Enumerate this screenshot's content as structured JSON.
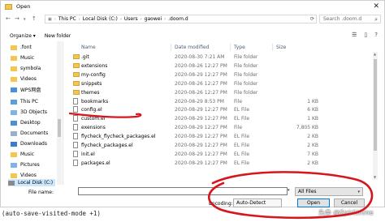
{
  "window": {
    "title": "Open",
    "close_glyph": "✕"
  },
  "address_bar": {
    "breadcrumbs": [
      "This PC",
      "Local Disk (C:)",
      "Users",
      "gaowei",
      ".doom.d"
    ],
    "refresh_glyph": "⟳"
  },
  "search": {
    "placeholder": "Search .doom.d",
    "icon": "search-icon"
  },
  "toolbar": {
    "organize_label": "Organize ▾",
    "new_folder_label": "New folder"
  },
  "nav": {
    "items": [
      {
        "label": ".font",
        "icon": "folder-icon"
      },
      {
        "label": "Music",
        "icon": "music-folder-icon"
      },
      {
        "label": "symbola",
        "icon": "folder-icon"
      },
      {
        "label": "Videos",
        "icon": "videos-folder-icon"
      },
      {
        "label": "WPS网盘",
        "icon": "cloud-drive-icon"
      },
      {
        "label": "This PC",
        "icon": "computer-icon"
      },
      {
        "label": "3D Objects",
        "icon": "3d-objects-icon"
      },
      {
        "label": "Desktop",
        "icon": "desktop-icon"
      },
      {
        "label": "Documents",
        "icon": "documents-icon"
      },
      {
        "label": "Downloads",
        "icon": "downloads-icon"
      },
      {
        "label": "Music",
        "icon": "music-folder-icon"
      },
      {
        "label": "Pictures",
        "icon": "pictures-icon"
      },
      {
        "label": "Videos",
        "icon": "videos-folder-icon"
      },
      {
        "label": "Local Disk (C:)",
        "icon": "drive-icon",
        "selected": true
      }
    ]
  },
  "columns": {
    "name": "Name",
    "date": "Date modified",
    "type": "Type",
    "size": "Size"
  },
  "files": [
    {
      "name": ".git",
      "date": "2020-08-30 7:21 AM",
      "type": "File folder",
      "size": "",
      "kind": "folder"
    },
    {
      "name": "extensions",
      "date": "2020-08-26 12:27 PM",
      "type": "File folder",
      "size": "",
      "kind": "folder"
    },
    {
      "name": "my-config",
      "date": "2020-08-29 12:27 PM",
      "type": "File folder",
      "size": "",
      "kind": "folder"
    },
    {
      "name": "snippets",
      "date": "2020-08-26 12:27 PM",
      "type": "File folder",
      "size": "",
      "kind": "folder"
    },
    {
      "name": "themes",
      "date": "2020-08-26 12:27 PM",
      "type": "File folder",
      "size": "",
      "kind": "folder"
    },
    {
      "name": "bookmarks",
      "date": "2020-08-29 8:53 PM",
      "type": "File",
      "size": "1 KB",
      "kind": "file"
    },
    {
      "name": "config.el",
      "date": "2020-08-29 12:27 PM",
      "type": "EL File",
      "size": "6 KB",
      "kind": "file"
    },
    {
      "name": "custom.el",
      "date": "2020-08-29 12:27 PM",
      "type": "EL File",
      "size": "1 KB",
      "kind": "file"
    },
    {
      "name": "exensions",
      "date": "2020-08-29 12:27 PM",
      "type": "File",
      "size": "7,805 KB",
      "kind": "file"
    },
    {
      "name": "flycheck_flycheck_packages.el",
      "date": "2020-08-29 12:27 PM",
      "type": "EL File",
      "size": "2 KB",
      "kind": "file"
    },
    {
      "name": "flycheck_packages.el",
      "date": "2020-08-29 12:27 PM",
      "type": "EL File",
      "size": "2 KB",
      "kind": "file"
    },
    {
      "name": "init.el",
      "date": "2020-08-29 12:27 PM",
      "type": "EL File",
      "size": "7 KB",
      "kind": "file"
    },
    {
      "name": "packages.el",
      "date": "2020-08-29 12:27 PM",
      "type": "EL File",
      "size": "2 KB",
      "kind": "file"
    }
  ],
  "footer": {
    "file_name_label": "File name:",
    "file_name_value": "",
    "filter_value": "All Files",
    "encoding_label": "Encoding:",
    "encoding_value": "Auto-Detect",
    "open_label": "Open",
    "cancel_label": "Cancel"
  },
  "background": {
    "editor_text": "(auto-save-visited-mode +1)",
    "watermark": "头条 @Spiritinme"
  },
  "colors": {
    "accent": "#0078d7",
    "selection": "#cce8ff",
    "folder": "#f3c74f",
    "annotation_ink": "#d8141c"
  }
}
